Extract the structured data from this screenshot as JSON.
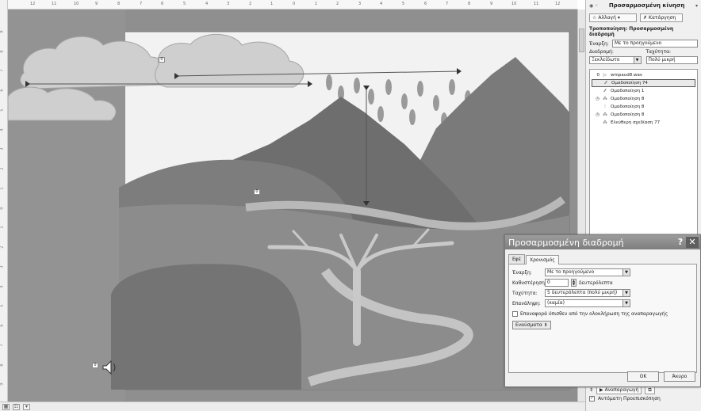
{
  "ruler": {
    "top_ticks": [
      "12",
      "11",
      "10",
      "9",
      "8",
      "7",
      "6",
      "5",
      "4",
      "3",
      "2",
      "1",
      "0",
      "1",
      "2",
      "3",
      "4",
      "5",
      "6",
      "7",
      "8",
      "9",
      "10",
      "11",
      "12"
    ],
    "left_ticks": [
      "9",
      "8",
      "7",
      "6",
      "5",
      "4",
      "3",
      "2",
      "1",
      "0",
      "1",
      "2",
      "3",
      "4",
      "5",
      "6",
      "7",
      "8",
      "9"
    ]
  },
  "slide": {
    "tags": [
      "0",
      "0",
      "0"
    ]
  },
  "taskpane": {
    "title": "Προσαρμοσμένη κίνηση",
    "change_button": "Αλλαγή",
    "remove_button": "Κατάργηση",
    "modify_heading": "Τροποποίηση: Προσαρμοσμένη διαδρομή",
    "start_label": "Έναρξη:",
    "start_value": "Με το προηγούμενο",
    "path_label": "Διαδρομή:",
    "speed_label": "Ταχύτητα:",
    "path_value": "Ξεκλείδωτο",
    "speed_value": "Πολύ μικρή",
    "items": [
      {
        "num": "0",
        "icon": "▷",
        "text": "wmpaud8.wav",
        "selected": false
      },
      {
        "num": "",
        "icon": "⁄⁄",
        "text": "Ομαδοποίηση 74",
        "selected": true
      },
      {
        "num": "",
        "icon": "⁄⁄",
        "text": "Ομαδοποίηση 1",
        "selected": false
      },
      {
        "num": "◷",
        "icon": "⁂",
        "text": "Ομαδοποίηση 8",
        "selected": false
      },
      {
        "num": "",
        "icon": "⁝",
        "text": "Ομαδοποίηση 8",
        "selected": false
      },
      {
        "num": "◷",
        "icon": "⁂",
        "text": "Ομαδοποίηση 8",
        "selected": false
      },
      {
        "num": "",
        "icon": "⁂",
        "text": "Ελεύθερη σχεδίαση 77",
        "selected": false
      }
    ],
    "play_button": "Αναπαραγωγή",
    "autopreview_label": "Αυτόματη Προεπισκόπηση"
  },
  "dialog": {
    "title": "Προσαρμοσμένη διαδρομή",
    "help": "?",
    "close": "✕",
    "tabs": [
      "Εφέ",
      "Χρονισμός"
    ],
    "start_label": "Έναρξη:",
    "start_value": "Με το προηγούμενο",
    "delay_label": "Καθυστέρηση:",
    "delay_value": "0",
    "delay_unit": "δευτερόλεπτα",
    "speed_label": "Ταχύτητα:",
    "speed_value": "5 δευτερόλεπτα (πολύ μικρή)",
    "repeat_label": "Επανάληψη:",
    "repeat_value": "(καμία)",
    "rewind_label": "Επαναφορά όπισθεν από την ολοκλήρωση της αναπαραγωγής",
    "triggers_button": "Εναύσματα ⇟",
    "ok": "OK",
    "cancel": "Άκυρο"
  },
  "colors": {
    "mountain": "#6b6b6b",
    "sky": "#f4f4f4",
    "hill": "#8a8a8a",
    "dialog_title": "#8c8c8c"
  }
}
